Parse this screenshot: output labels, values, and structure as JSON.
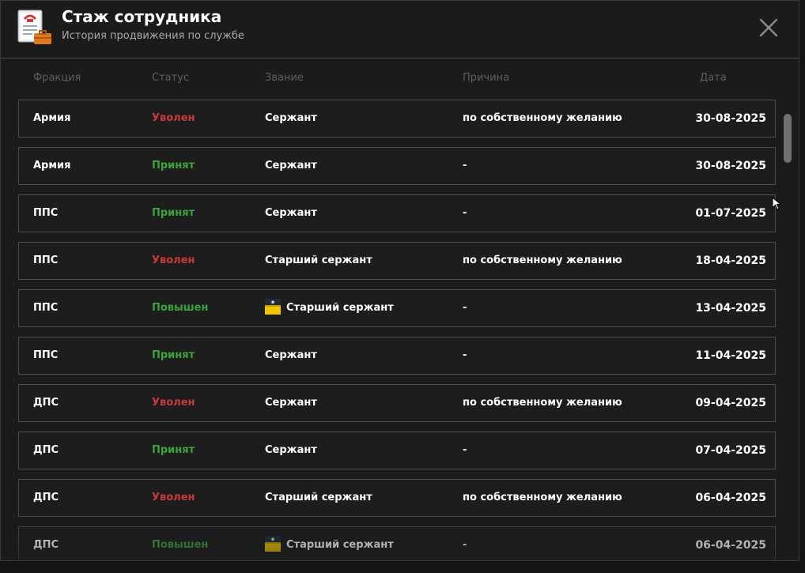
{
  "window": {
    "title": "Стаж сотрудника",
    "subtitle": "История продвижения по службе",
    "icon": "document-briefcase-icon",
    "close_icon": "close-icon"
  },
  "columns": {
    "faction": "Фракция",
    "status": "Статус",
    "rank": "Звание",
    "reason": "Причина",
    "date": "Дата"
  },
  "colors": {
    "fired": "#c83a3a",
    "hired": "#3aa33a",
    "promoted": "#3aa33a"
  },
  "rows": [
    {
      "faction": "Армия",
      "status": "Уволен",
      "status_type": "fired",
      "rank": "Сержант",
      "rank_icon": false,
      "reason": "по собственному желанию",
      "date": "30-08-2025"
    },
    {
      "faction": "Армия",
      "status": "Принят",
      "status_type": "hired",
      "rank": "Сержант",
      "rank_icon": false,
      "reason": "-",
      "date": "30-08-2025"
    },
    {
      "faction": "ППС",
      "status": "Принят",
      "status_type": "hired",
      "rank": "Сержант",
      "rank_icon": false,
      "reason": "-",
      "date": "01-07-2025"
    },
    {
      "faction": "ППС",
      "status": "Уволен",
      "status_type": "fired",
      "rank": "Старший сержант",
      "rank_icon": false,
      "reason": "по собственному желанию",
      "date": "18-04-2025"
    },
    {
      "faction": "ППС",
      "status": "Повышен",
      "status_type": "promoted",
      "rank": "Старший сержант",
      "rank_icon": true,
      "reason": "-",
      "date": "13-04-2025"
    },
    {
      "faction": "ППС",
      "status": "Принят",
      "status_type": "hired",
      "rank": "Сержант",
      "rank_icon": false,
      "reason": "-",
      "date": "11-04-2025"
    },
    {
      "faction": "ДПС",
      "status": "Уволен",
      "status_type": "fired",
      "rank": "Сержант",
      "rank_icon": false,
      "reason": "по собственному желанию",
      "date": "09-04-2025"
    },
    {
      "faction": "ДПС",
      "status": "Принят",
      "status_type": "hired",
      "rank": "Сержант",
      "rank_icon": false,
      "reason": "-",
      "date": "07-04-2025"
    },
    {
      "faction": "ДПС",
      "status": "Уволен",
      "status_type": "fired",
      "rank": "Старший сержант",
      "rank_icon": false,
      "reason": "по собственному желанию",
      "date": "06-04-2025"
    },
    {
      "faction": "ДПС",
      "status": "Повышен",
      "status_type": "promoted",
      "rank": "Старший сержант",
      "rank_icon": true,
      "reason": "-",
      "date": "06-04-2025"
    }
  ]
}
